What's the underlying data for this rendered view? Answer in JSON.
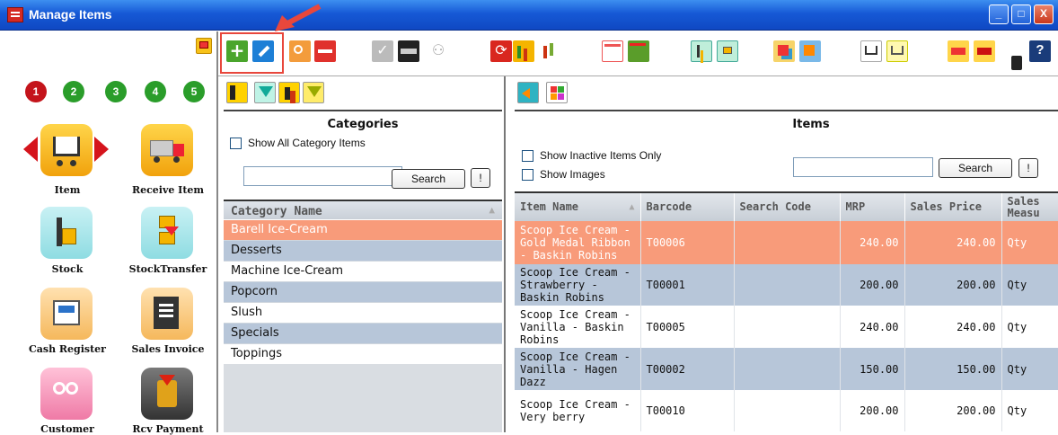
{
  "window": {
    "title": "Manage Items",
    "buttons": [
      "_",
      "□",
      "X"
    ]
  },
  "toolbar": {
    "help_label": "?",
    "icons": [
      "add-icon",
      "edit-icon",
      "search-icon",
      "delete-icon",
      "check-icon",
      "calculator-icon",
      "hierarchy-icon",
      "refresh-icon",
      "bar-chart-icon",
      "bar-chart-red-icon",
      "table-icon",
      "table-down-icon",
      "stock-icon",
      "transfer-icon",
      "category-icon",
      "category-alt-icon",
      "cart-icon",
      "cart-alt-icon",
      "truck-icon",
      "truck-alt-icon",
      "dropdown-icon",
      "help-icon"
    ]
  },
  "steps": [
    "1",
    "2",
    "3",
    "4",
    "5"
  ],
  "step_colors": [
    "#c4141b",
    "#2a9d2a",
    "#2a9d2a",
    "#2a9d2a",
    "#2a9d2a"
  ],
  "tiles": [
    {
      "label": "Item",
      "icon": "cart-icon"
    },
    {
      "label": "Receive Item",
      "icon": "truck-icon"
    },
    {
      "label": "Stock",
      "icon": "stock-icon"
    },
    {
      "label": "StockTransfer",
      "icon": "transfer-icon"
    },
    {
      "label": "Cash Register",
      "icon": "cash-register-icon"
    },
    {
      "label": "Sales Invoice",
      "icon": "invoice-icon"
    },
    {
      "label": "Customer",
      "icon": "customer-icon"
    },
    {
      "label": "Rcv Payment",
      "icon": "payment-icon"
    }
  ],
  "categories": {
    "title": "Categories",
    "show_all_label": "Show All Category Items",
    "search_label": "Search",
    "bang_label": "!",
    "column": "Category Name",
    "rows": [
      "Barell Ice-Cream",
      "Desserts",
      "Machine Ice-Cream",
      "Popcorn",
      "Slush",
      "Specials",
      "Toppings"
    ]
  },
  "items": {
    "title": "Items",
    "show_inactive_label": "Show Inactive Items Only",
    "show_images_label": "Show Images",
    "search_label": "Search",
    "bang_label": "!",
    "columns": [
      "Item Name",
      "Barcode",
      "Search Code",
      "MRP",
      "Sales Price",
      "Sales Measu"
    ],
    "rows": [
      {
        "name": "Scoop Ice Cream - Gold Medal Ribbon - Baskin Robins",
        "barcode": "T00006",
        "search_code": "",
        "mrp": "240.00",
        "price": "240.00",
        "measure": "Qty"
      },
      {
        "name": "Scoop Ice Cream - Strawberry - Baskin Robins",
        "barcode": "T00001",
        "search_code": "",
        "mrp": "200.00",
        "price": "200.00",
        "measure": "Qty"
      },
      {
        "name": "Scoop Ice Cream - Vanilla - Baskin Robins",
        "barcode": "T00005",
        "search_code": "",
        "mrp": "240.00",
        "price": "240.00",
        "measure": "Qty"
      },
      {
        "name": "Scoop Ice Cream - Vanilla - Hagen Dazz",
        "barcode": "T00002",
        "search_code": "",
        "mrp": "150.00",
        "price": "150.00",
        "measure": "Qty"
      },
      {
        "name": "Scoop Ice Cream - Very berry",
        "barcode": "T00010",
        "search_code": "",
        "mrp": "200.00",
        "price": "200.00",
        "measure": "Qty"
      }
    ]
  }
}
